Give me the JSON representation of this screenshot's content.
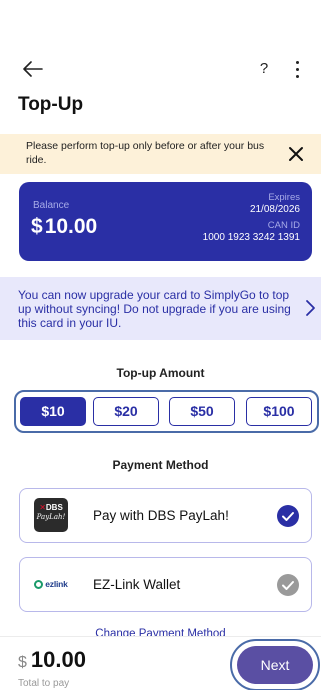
{
  "header": {
    "title": "Top-Up",
    "help_label": "?",
    "back_icon": "arrow-left-icon",
    "more_icon": "more-vertical-icon"
  },
  "notice": {
    "text": "Please perform top-up only before or after your bus ride.",
    "close_icon": "close-icon",
    "background": "#fdf1d9"
  },
  "card": {
    "balance_label": "Balance",
    "currency": "$",
    "balance_value": "10.00",
    "expires_label": "Expires",
    "expires_value": "21/08/2026",
    "can_label": "CAN ID",
    "can_value": "1000 1923 3242 1391",
    "color": "#2a2fa5"
  },
  "upgrade_banner": {
    "text": "You can now upgrade your card to SimplyGo to top up without syncing! Do not upgrade if you are using this card in your IU.",
    "chevron_icon": "chevron-right-icon"
  },
  "topup": {
    "title": "Top-up Amount",
    "amounts": [
      {
        "label": "$10",
        "selected": true
      },
      {
        "label": "$20",
        "selected": false
      },
      {
        "label": "$50",
        "selected": false
      },
      {
        "label": "$100",
        "selected": false
      }
    ]
  },
  "payment": {
    "title": "Payment Method",
    "options": [
      {
        "label": "Pay with DBS PayLah!",
        "logo_top": "DBS",
        "logo_bottom": "PayLah!",
        "selected": true
      },
      {
        "label": "EZ-Link Wallet",
        "logo_text": "ezlink",
        "selected": false
      }
    ],
    "change_label": "Change Payment Method"
  },
  "footer": {
    "currency": "$",
    "total_value": "10.00",
    "total_label": "Total to pay",
    "next_label": "Next"
  }
}
